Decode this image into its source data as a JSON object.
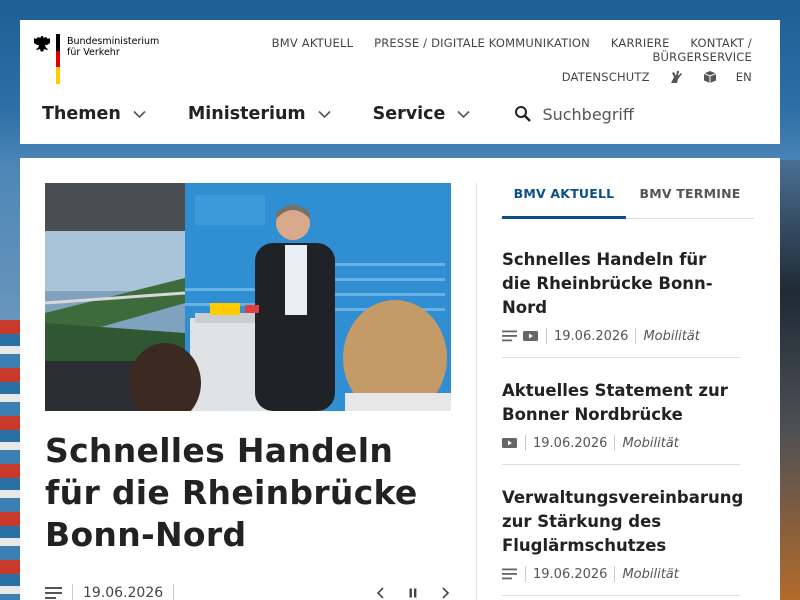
{
  "logo": {
    "line1": "Bundesministerium",
    "line2": "für Verkehr",
    "flag_colors": [
      "#000000",
      "#dd0000",
      "#ffcc00"
    ]
  },
  "top_links": {
    "row1": [
      "BMV AKTUELL",
      "PRESSE / DIGITALE KOMMUNIKATION",
      "KARRIERE",
      "KONTAKT / BÜRGERSERVICE"
    ],
    "datenschutz": "DATENSCHUTZ",
    "icons": [
      "sign-language-icon",
      "easy-language-icon"
    ],
    "language": "EN"
  },
  "main_nav": {
    "items": [
      "Themen",
      "Ministerium",
      "Service"
    ],
    "search_placeholder": "Suchbegriff"
  },
  "hero": {
    "title": "Schnelles Handeln für die Rheinbrücke Bonn-Nord",
    "date": "19.06.2026",
    "icon": "article-lines-icon",
    "controls": [
      "previous-icon",
      "pause-icon",
      "next-icon"
    ]
  },
  "tabs": {
    "active": "BMV AKTUELL",
    "inactive": "BMV TERMINE"
  },
  "news": [
    {
      "title": "Schnelles Handeln für die Rheinbrücke Bonn-Nord",
      "icons": [
        "article-lines-icon",
        "video-icon"
      ],
      "date": "19.06.2026",
      "category": "Mobilität"
    },
    {
      "title": "Aktuelles Statement zur Bonner Nordbrücke",
      "icons": [
        "video-icon"
      ],
      "date": "19.06.2026",
      "category": "Mobilität"
    },
    {
      "title": "Verwaltungsvereinbarung zur Stärkung des Fluglärmschutzes",
      "icons": [
        "article-lines-icon"
      ],
      "date": "19.06.2026",
      "category": "Mobilität"
    }
  ],
  "colors": {
    "accent": "#0c4f86",
    "text": "#222222",
    "hero_backdrop": "#2f8fd2"
  }
}
